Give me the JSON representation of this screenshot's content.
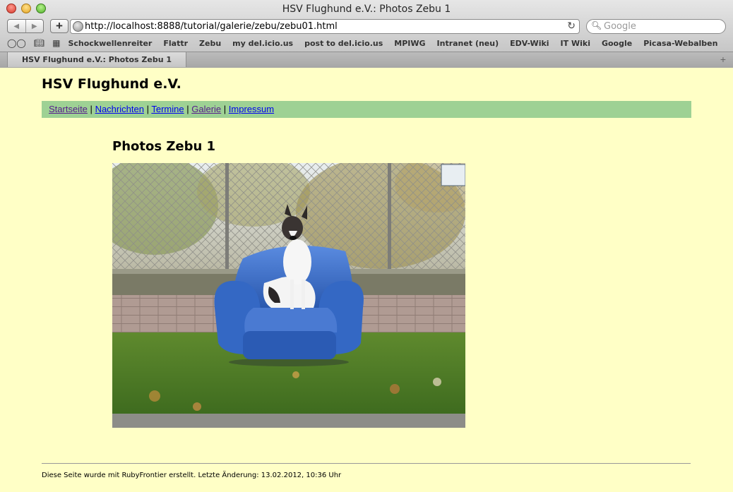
{
  "window": {
    "title": "HSV Flughund e.V.: Photos Zebu 1"
  },
  "toolbar": {
    "url": "http://localhost:8888/tutorial/galerie/zebu/zebu01.html",
    "search_placeholder": "Google",
    "back_icon": "back-arrow-icon",
    "forward_icon": "forward-arrow-icon",
    "add_icon": "plus-icon",
    "reload_icon": "reload-icon"
  },
  "bookmarks": {
    "items": [
      "Schockwellenreiter",
      "Flattr",
      "Zebu",
      "my del.icio.us",
      "post to del.icio.us",
      "MPIWG",
      "Intranet (neu)",
      "EDV-Wiki",
      "IT Wiki",
      "Google",
      "Picasa-Webalben"
    ]
  },
  "tab": {
    "label": "HSV Flughund e.V.: Photos Zebu 1"
  },
  "site": {
    "title": "HSV Flughund e.V.",
    "nav": [
      {
        "label": "Startseite"
      },
      {
        "label": "Nachrichten"
      },
      {
        "label": "Termine"
      },
      {
        "label": "Galerie"
      },
      {
        "label": "Impressum"
      }
    ],
    "separator": "|"
  },
  "main": {
    "heading": "Photos Zebu 1",
    "photo_subject": "dog-sitting-on-blue-armchair"
  },
  "footer": {
    "text": "Diese Seite wurde mit RubyFrontier erstellt. Letzte Änderung: 13.02.2012, 10:36 Uhr"
  },
  "colors": {
    "page_background": "#ffffc6",
    "nav_background": "#9ed194",
    "link": "#0000ee",
    "visited_link": "#551a8b"
  }
}
